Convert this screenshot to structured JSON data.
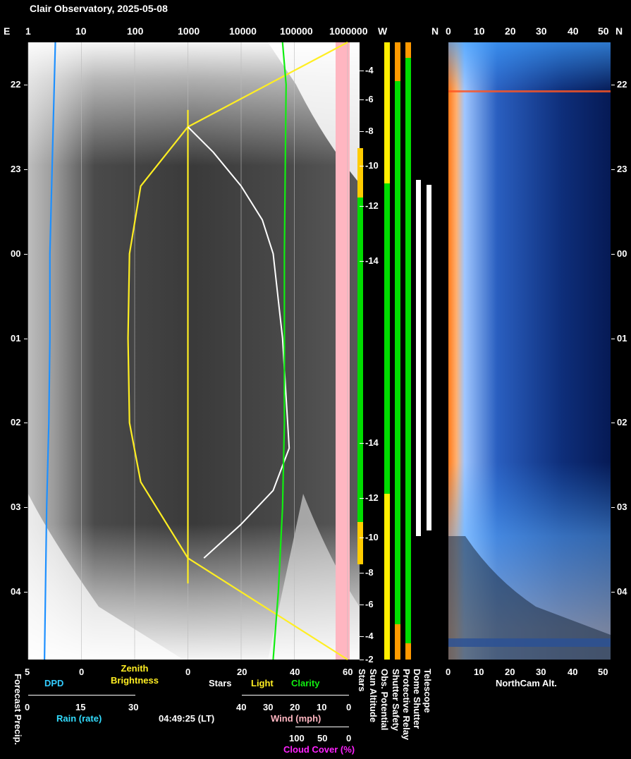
{
  "title": "Clair Observatory, 2025-05-08",
  "timestamp": "04:49:25 (LT)",
  "colors": {
    "dpd": "#1e90ff",
    "rain_label": "#33ddff",
    "zenith": "#ffee22",
    "light": "#ffee22",
    "stars": "#ffffff",
    "clarity": "#11ee11",
    "wind": "#ffb6c1",
    "cloud_cover": "#ff22ff",
    "status_ok": "#00dd00",
    "status_warn": "#ff9900",
    "status_caution": "#ffee00"
  },
  "top_axis": {
    "left_edge": "E",
    "brightness_ticks": [
      "1",
      "10",
      "100",
      "1000",
      "10000",
      "100000",
      "1000000"
    ],
    "status_labels": [
      "W",
      "N"
    ],
    "northcam_ticks": [
      "0",
      "10",
      "20",
      "30",
      "40",
      "50"
    ],
    "right_edge": "N"
  },
  "hour_labels": [
    "22",
    "23",
    "00",
    "01",
    "02",
    "03",
    "04"
  ],
  "sun_altitude_labels": [
    "-4",
    "-6",
    "-8",
    "-10",
    "-12",
    "-14",
    "-14",
    "-12",
    "-10",
    "-8",
    "-6",
    "-4",
    "-2"
  ],
  "bottom_axes": {
    "forecast_precip": "Forecast Precip.",
    "dpd": {
      "ticks": [
        "5",
        "0"
      ],
      "label": "DPD"
    },
    "zenith": {
      "label": "Zenith\nBrightness"
    },
    "light_clarity": {
      "ticks": [
        "0",
        "20",
        "40",
        "60"
      ],
      "labels": [
        "Stars",
        "Light",
        "Clarity"
      ]
    },
    "rain": {
      "ticks": [
        "0",
        "15",
        "30"
      ],
      "label": "Rain (rate)"
    },
    "wind": {
      "ticks": [
        "40",
        "30",
        "20",
        "10",
        "0"
      ],
      "label": "Wind (mph)"
    },
    "cloud": {
      "ticks": [
        "100",
        "50",
        "0"
      ],
      "label": "Cloud Cover (%)"
    },
    "status_vertical": [
      "Stars",
      "Sun Altitude",
      "Obs. Potential",
      "Shutter Safety",
      "Protective Relay",
      "Dome Shutter",
      "Telescope"
    ],
    "northcam": {
      "ticks": [
        "0",
        "10",
        "20",
        "30",
        "40",
        "50"
      ],
      "label": "NorthCam Alt."
    }
  },
  "chart_data": {
    "type": "line",
    "x_axis": "brightness (log scale)",
    "x_ticks": [
      1,
      10,
      100,
      1000,
      10000,
      100000,
      1000000
    ],
    "y_axis": "local time (hours)",
    "y_range": [
      "21:30",
      "04:50"
    ],
    "series": [
      {
        "name": "Zenith Brightness",
        "color": "#ffee22",
        "points": [
          [
            1000000,
            21.5
          ],
          [
            1000,
            22.5
          ],
          [
            130,
            23.2
          ],
          [
            80,
            0.0
          ],
          [
            75,
            1.0
          ],
          [
            80,
            2.0
          ],
          [
            130,
            2.7
          ],
          [
            1000,
            3.6
          ],
          [
            1000000,
            4.8
          ]
        ]
      },
      {
        "name": "Light",
        "color": "#ffee22",
        "points": [
          [
            1000,
            22.3
          ],
          [
            1000,
            23.6
          ],
          [
            1000,
            3.6
          ],
          [
            1000,
            3.9
          ]
        ]
      },
      {
        "name": "Stars",
        "color": "#ffffff",
        "points": [
          [
            1000,
            22.5
          ],
          [
            3000,
            22.8
          ],
          [
            10000,
            23.2
          ],
          [
            25000,
            23.6
          ],
          [
            40000,
            0.0
          ],
          [
            60000,
            1.0
          ],
          [
            80000,
            2.3
          ],
          [
            40000,
            2.8
          ],
          [
            10000,
            3.2
          ],
          [
            2000,
            3.6
          ]
        ]
      },
      {
        "name": "Clarity",
        "color": "#11ee11",
        "points": [
          [
            60000,
            21.5
          ],
          [
            70000,
            22.0
          ],
          [
            65000,
            0.0
          ],
          [
            65000,
            2.0
          ],
          [
            60000,
            3.0
          ],
          [
            50000,
            4.0
          ],
          [
            40000,
            4.8
          ]
        ]
      },
      {
        "name": "DPD",
        "color": "#1e90ff",
        "points": [
          [
            2.5,
            21.5
          ],
          [
            2.6,
            22.0
          ],
          [
            2.8,
            23.0
          ],
          [
            3.0,
            0.0
          ],
          [
            3.0,
            1.0
          ],
          [
            3.1,
            2.0
          ],
          [
            3.3,
            3.0
          ],
          [
            3.5,
            4.8
          ]
        ]
      }
    ]
  }
}
